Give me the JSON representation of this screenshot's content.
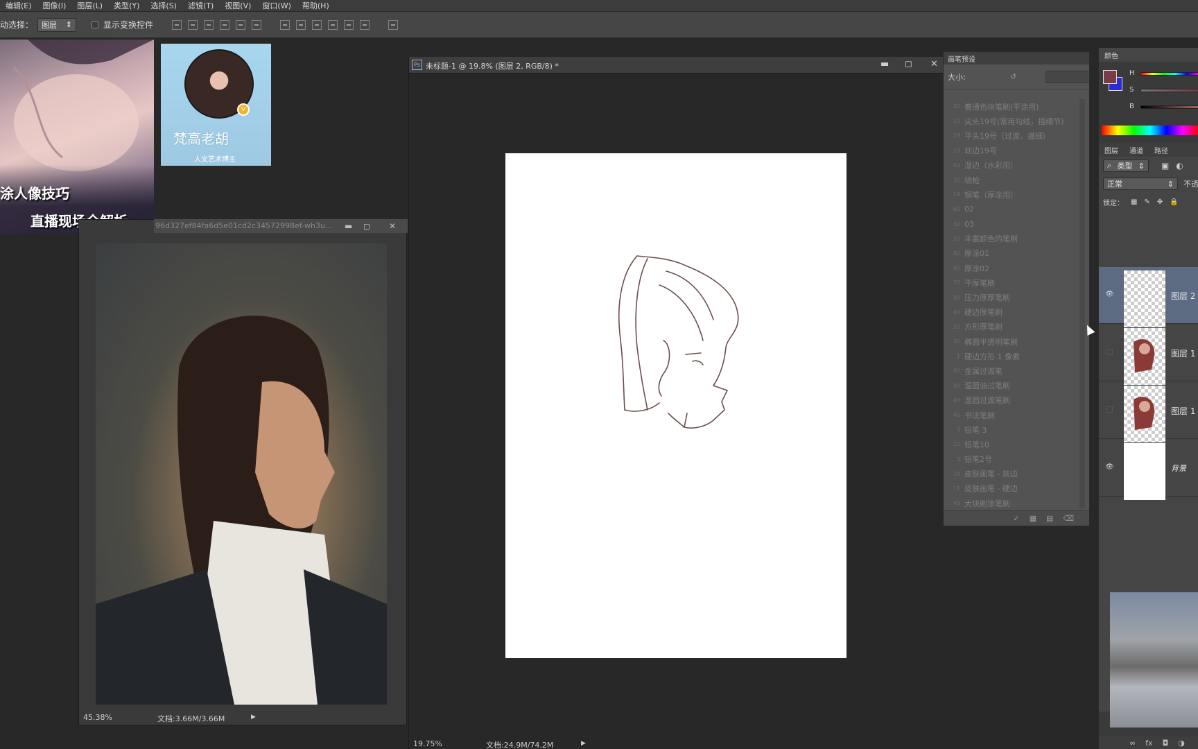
{
  "menu": [
    "编辑(E)",
    "图像(I)",
    "图层(L)",
    "类型(Y)",
    "选择(S)",
    "滤镜(T)",
    "视图(V)",
    "窗口(W)",
    "帮助(H)"
  ],
  "options": {
    "auto_select_label": "动选择：",
    "auto_select_value": "图层",
    "show_transform_label": "显示变换控件"
  },
  "promo": {
    "line1": "涂人像技巧",
    "line2": "直播现场全解析"
  },
  "profile": {
    "name": "梵高老胡",
    "subtitle": "人文艺术博主"
  },
  "reference_window": {
    "title": "96d327ef84fa6d5e01cd2c34572998ef-wh3u...",
    "zoom": "45.38%",
    "doc_info": "文档:3.66M/3.66M"
  },
  "document_window": {
    "title": "未标题-1 @ 19.8% (图层 2, RGB/8) *",
    "zoom": "19.75%",
    "doc_info": "文档:24.9M/74.2M"
  },
  "brush_panel": {
    "title": "画笔预设",
    "size_label": "大小:",
    "brushes": [
      {
        "num": "30",
        "name": "普通色块笔刷(平涂用)"
      },
      {
        "num": "10",
        "name": "尖头19号(常用勾线，描细节)"
      },
      {
        "num": "19",
        "name": "平头19号（过渡，描细）"
      },
      {
        "num": "19",
        "name": "软边19号"
      },
      {
        "num": "64",
        "name": "湿边（水彩用）"
      },
      {
        "num": "30",
        "name": "喷枪"
      },
      {
        "num": "19",
        "name": "钢笔（厚涂用）"
      },
      {
        "num": "60",
        "name": "02"
      },
      {
        "num": "30",
        "name": "03"
      },
      {
        "num": "35",
        "name": "丰富颜色的笔刷"
      },
      {
        "num": "60",
        "name": "厚涂01"
      },
      {
        "num": "60",
        "name": "厚涂02"
      },
      {
        "num": "70",
        "name": "干厚笔刷"
      },
      {
        "num": "90",
        "name": "压力厚厚笔刷"
      },
      {
        "num": "40",
        "name": "硬边厚笔刷"
      },
      {
        "num": "55",
        "name": "方形厚笔刷"
      },
      {
        "num": "30",
        "name": "椭圆半透明笔刷"
      },
      {
        "num": "1",
        "name": "硬边方形 1 像素"
      },
      {
        "num": "65",
        "name": "金属过渡笔"
      },
      {
        "num": "40",
        "name": "湿圆油过笔刷"
      },
      {
        "num": "40",
        "name": "湿圆过渡笔刷"
      },
      {
        "num": "40",
        "name": "书法笔刷"
      },
      {
        "num": "3",
        "name": "铅笔 3"
      },
      {
        "num": "10",
        "name": "铅笔10"
      },
      {
        "num": "3",
        "name": "铅笔2号"
      },
      {
        "num": "18",
        "name": "皮肤画笔 - 软边"
      },
      {
        "num": "11",
        "name": "皮肤画笔 - 硬边"
      },
      {
        "num": "45",
        "name": "大块刷涂笔刷"
      }
    ]
  },
  "color_panel": {
    "title": "颜色",
    "labels": [
      "H",
      "S",
      "B"
    ],
    "foreground": "#7a3c46",
    "background": "#2b2bd6"
  },
  "layers_panel": {
    "tabs": [
      "图层",
      "通道",
      "路径"
    ],
    "filter_value": "类型",
    "blend_mode": "正常",
    "opacity_label": "不透",
    "lock_label": "锁定：",
    "layers": [
      {
        "name": "图层 2",
        "visible": true,
        "selected": true
      },
      {
        "name": "图层 1",
        "visible": false,
        "selected": false
      },
      {
        "name": "图层 1",
        "visible": false,
        "selected": false
      },
      {
        "name": "背景",
        "visible": true,
        "selected": false
      }
    ]
  }
}
